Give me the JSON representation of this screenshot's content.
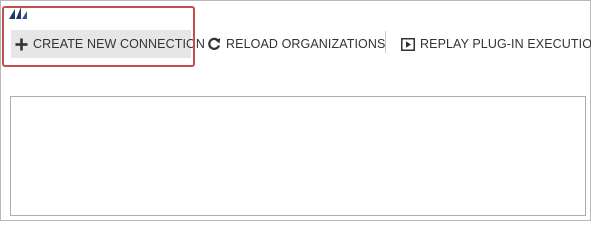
{
  "toolbar": {
    "create_connection_label": "CREATE NEW CONNECTION",
    "reload_organizations_label": "RELOAD ORGANIZATIONS",
    "replay_plugin_label": "REPLAY PLUG-IN EXECUTION"
  },
  "icons": {
    "logo": "app-logo",
    "create": "plus-icon",
    "reload": "refresh-icon",
    "replay": "play-icon"
  },
  "colors": {
    "highlight": "#c0504d",
    "active_button_bg": "#e6e6e6",
    "logo": "#1f3864",
    "text": "#333333"
  }
}
